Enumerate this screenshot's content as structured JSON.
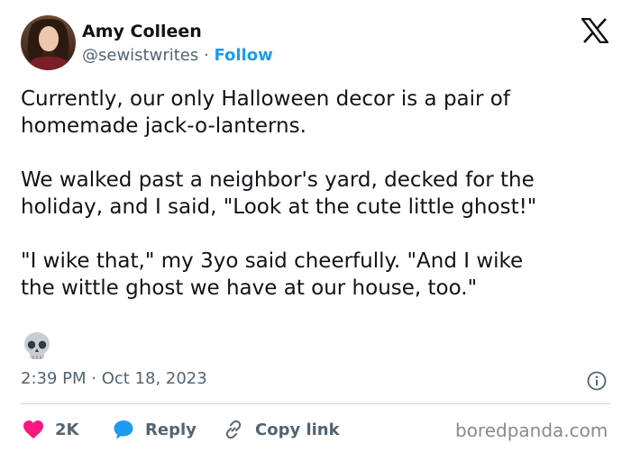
{
  "author": {
    "name": "Amy Colleen",
    "handle": "@sewistwrites",
    "separator": "·",
    "follow_label": "Follow"
  },
  "tweet": {
    "paragraphs": [
      [
        "Currently, our only Halloween decor is a pair of",
        "homemade jack-o-lanterns."
      ],
      [
        "We walked past a neighbor's yard, decked for the",
        "holiday, and I said, \"Look at the cute little ghost!\""
      ],
      [
        "\"I wike that,\" my 3yo said cheerfully. \"And I wike",
        "the wittle ghost we have at our house, too.\""
      ]
    ],
    "emoji": "skull-emoji",
    "timestamp": "2:39 PM · Oct 18, 2023"
  },
  "actions": {
    "like_count": "2K",
    "reply_label": "Reply",
    "copy_link_label": "Copy link"
  },
  "watermark": "boredpanda.com",
  "icons": {
    "brand": "x-logo-icon",
    "info": "info-icon",
    "like": "heart-icon",
    "reply": "speech-bubble-icon",
    "copy": "link-icon"
  },
  "colors": {
    "link_blue": "#1d9bf0",
    "heart_pink": "#f91880",
    "muted": "#536471",
    "text": "#0f1419"
  }
}
